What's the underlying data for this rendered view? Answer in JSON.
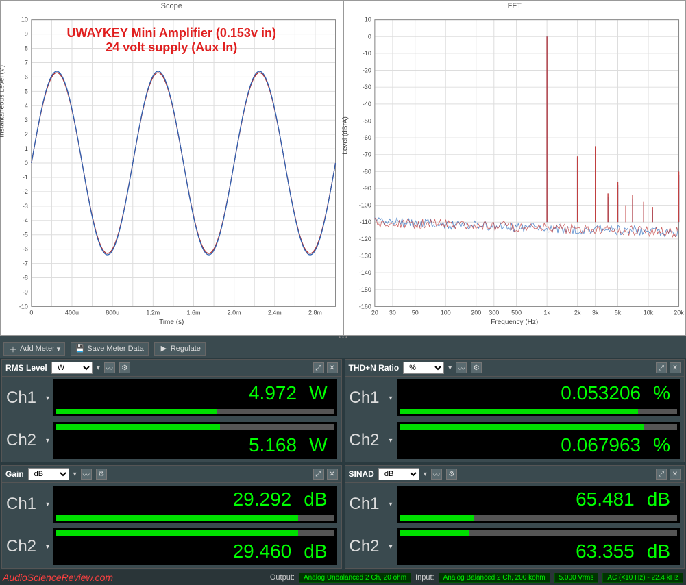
{
  "scope": {
    "title": "Scope",
    "ylabel": "Instantaneous Level (V)",
    "xlabel": "Time (s)",
    "annotation_line1": "UWAYKEY Mini Amplifier (0.153v in)",
    "annotation_line2": "24 volt supply (Aux In)"
  },
  "fft": {
    "title": "FFT",
    "ylabel": "Level (dBrA)",
    "xlabel": "Frequency (Hz)"
  },
  "toolbar": {
    "add_meter": "Add Meter",
    "save_meter": "Save Meter Data",
    "regulate": "Regulate"
  },
  "meters": {
    "rms": {
      "title": "RMS Level",
      "unit": "W",
      "ch1": {
        "label": "Ch1",
        "value": "4.972",
        "unit": "W",
        "bar": 58
      },
      "ch2": {
        "label": "Ch2",
        "value": "5.168",
        "unit": "W",
        "bar": 59
      }
    },
    "thdn": {
      "title": "THD+N Ratio",
      "unit": "%",
      "ch1": {
        "label": "Ch1",
        "value": "0.053206",
        "unit": "%",
        "bar": 86
      },
      "ch2": {
        "label": "Ch2",
        "value": "0.067963",
        "unit": "%",
        "bar": 88
      }
    },
    "gain": {
      "title": "Gain",
      "unit": "dB",
      "ch1": {
        "label": "Ch1",
        "value": "29.292",
        "unit": "dB",
        "bar": 87
      },
      "ch2": {
        "label": "Ch2",
        "value": "29.460",
        "unit": "dB",
        "bar": 87
      }
    },
    "sinad": {
      "title": "SINAD",
      "unit": "dB",
      "ch1": {
        "label": "Ch1",
        "value": "65.481",
        "unit": "dB",
        "bar": 27
      },
      "ch2": {
        "label": "Ch2",
        "value": "63.355",
        "unit": "dB",
        "bar": 25
      }
    }
  },
  "statusbar": {
    "brand": "AudioScienceReview.com",
    "output_label": "Output:",
    "output_chip": "Analog Unbalanced 2 Ch, 20 ohm",
    "input_label": "Input:",
    "input_chip": "Analog Balanced 2 Ch, 200 kohm",
    "vrms_chip": "5.000 Vrms",
    "ac_chip": "AC (<10 Hz) - 22.4 kHz"
  },
  "chart_data": [
    {
      "type": "line",
      "title": "Scope",
      "xlabel": "Time (s)",
      "ylabel": "Instantaneous Level (V)",
      "xlim": [
        0,
        0.003
      ],
      "ylim": [
        -10,
        10
      ],
      "x_ticks": [
        "0",
        "400u",
        "800u",
        "1.2m",
        "1.6m",
        "2.0m",
        "2.4m",
        "2.8m"
      ],
      "y_ticks": [
        -10,
        -9,
        -8,
        -7,
        -6,
        -5,
        -4,
        -3,
        -2,
        -1,
        0,
        1,
        2,
        3,
        4,
        5,
        6,
        7,
        8,
        9,
        10
      ],
      "annotations": [
        "UWAYKEY Mini Amplifier (0.153v in)",
        "24 volt supply (Aux In)"
      ],
      "series": [
        {
          "name": "Ch1",
          "description": "~1 kHz sine, amplitude ≈ 6.3 V, phase 0",
          "frequency_hz": 1000,
          "amplitude_v": 6.3,
          "color": "#b03030"
        },
        {
          "name": "Ch2",
          "description": "~1 kHz sine, amplitude ≈ 6.4 V, phase 0 (overlaps Ch1)",
          "frequency_hz": 1000,
          "amplitude_v": 6.4,
          "color": "#3060b0"
        }
      ]
    },
    {
      "type": "line",
      "title": "FFT",
      "xlabel": "Frequency (Hz)",
      "ylabel": "Level (dBrA)",
      "xscale": "log",
      "xlim": [
        20,
        20000
      ],
      "ylim": [
        -160,
        10
      ],
      "x_ticks": [
        "20",
        "30",
        "50",
        "100",
        "200",
        "300",
        "500",
        "1k",
        "2k",
        "3k",
        "5k",
        "10k",
        "20k"
      ],
      "y_ticks": [
        10,
        0,
        -10,
        -20,
        -30,
        -40,
        -50,
        -60,
        -70,
        -80,
        -90,
        -100,
        -110,
        -120,
        -130,
        -140,
        -150,
        -160
      ],
      "noise_floor_dbra": -110,
      "series": [
        {
          "name": "Ch1",
          "color": "#3070c0",
          "peaks": [
            {
              "freq_hz": 1000,
              "level_dbra": 0
            },
            {
              "freq_hz": 2000,
              "level_dbra": -72
            },
            {
              "freq_hz": 3000,
              "level_dbra": -67
            },
            {
              "freq_hz": 4000,
              "level_dbra": -95
            },
            {
              "freq_hz": 5000,
              "level_dbra": -88
            },
            {
              "freq_hz": 6000,
              "level_dbra": -102
            },
            {
              "freq_hz": 7000,
              "level_dbra": -96
            },
            {
              "freq_hz": 9000,
              "level_dbra": -100
            },
            {
              "freq_hz": 11000,
              "level_dbra": -103
            },
            {
              "freq_hz": 20000,
              "level_dbra": -82
            }
          ]
        },
        {
          "name": "Ch2",
          "color": "#c04040",
          "peaks": [
            {
              "freq_hz": 1000,
              "level_dbra": 0
            },
            {
              "freq_hz": 2000,
              "level_dbra": -71
            },
            {
              "freq_hz": 3000,
              "level_dbra": -65
            },
            {
              "freq_hz": 4000,
              "level_dbra": -93
            },
            {
              "freq_hz": 5000,
              "level_dbra": -86
            },
            {
              "freq_hz": 6000,
              "level_dbra": -100
            },
            {
              "freq_hz": 7000,
              "level_dbra": -94
            },
            {
              "freq_hz": 9000,
              "level_dbra": -98
            },
            {
              "freq_hz": 11000,
              "level_dbra": -101
            },
            {
              "freq_hz": 20000,
              "level_dbra": -80
            }
          ]
        }
      ]
    }
  ]
}
